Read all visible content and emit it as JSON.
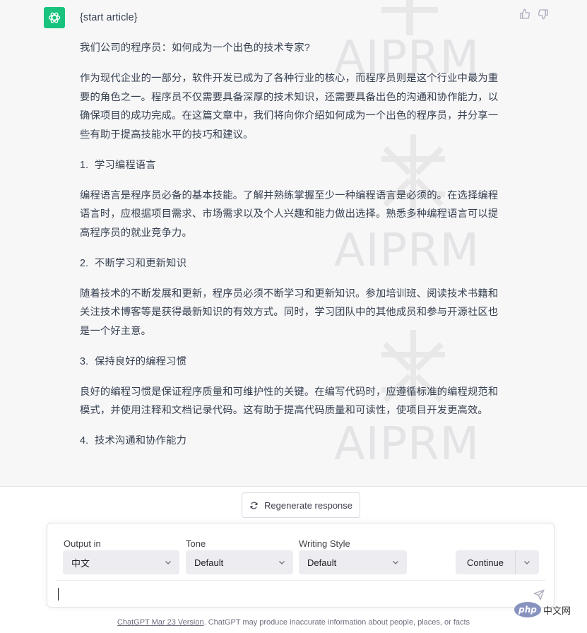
{
  "conversation": {
    "paragraphs": [
      {
        "text": "{start article}"
      },
      {
        "text": "我们公司的程序员：如何成为一个出色的技术专家?"
      },
      {
        "text": "作为现代企业的一部分，软件开发已成为了各种行业的核心，而程序员则是这个行业中最为重要的角色之一。程序员不仅需要具备深厚的技术知识，还需要具备出色的沟通和协作能力，以确保项目的成功完成。在这篇文章中，我们将向你介绍如何成为一个出色的程序员，并分享一些有助于提高技能水平的技巧和建议。"
      },
      {
        "num": "1.",
        "text": "学习编程语言"
      },
      {
        "text": "编程语言是程序员必备的基本技能。了解并熟练掌握至少一种编程语言是必须的。在选择编程语言时，应根据项目需求、市场需求以及个人兴趣和能力做出选择。熟悉多种编程语言可以提高程序员的就业竞争力。"
      },
      {
        "num": "2.",
        "text": "不断学习和更新知识"
      },
      {
        "text": "随着技术的不断发展和更新，程序员必须不断学习和更新知识。参加培训班、阅读技术书籍和关注技术博客等是获得最新知识的有效方式。同时，学习团队中的其他成员和参与开源社区也是一个好主意。"
      },
      {
        "num": "3.",
        "text": "保持良好的编程习惯"
      },
      {
        "text": "良好的编程习惯是保证程序质量和可维护性的关键。在编写代码时，应遵循标准的编程规范和模式，并使用注释和文档记录代码。这有助于提高代码质量和可读性，使项目开发更高效。"
      },
      {
        "num": "4.",
        "text": "技术沟通和协作能力"
      }
    ],
    "watermark_text": "AIPRM"
  },
  "regenerate_label": "Regenerate response",
  "panel": {
    "output_label": "Output in",
    "output_value": "中文",
    "tone_label": "Tone",
    "tone_value": "Default",
    "style_label": "Writing Style",
    "style_value": "Default",
    "continue_label": "Continue",
    "prompt_value": ""
  },
  "footer": {
    "link": "ChatGPT Mar 23 Version",
    "text": ". ChatGPT may produce inaccurate information about people, places, or facts"
  },
  "php_logo": {
    "oval": "php",
    "text": "中文网"
  },
  "colors": {
    "avatar": "#19c37d",
    "conversation_bg": "#f7f7f8",
    "select_bg": "#ececf1"
  },
  "icons": [
    "chatgpt-logo-icon",
    "thumbs-up-icon",
    "thumbs-down-icon",
    "refresh-icon",
    "chevron-down-icon",
    "send-icon"
  ]
}
